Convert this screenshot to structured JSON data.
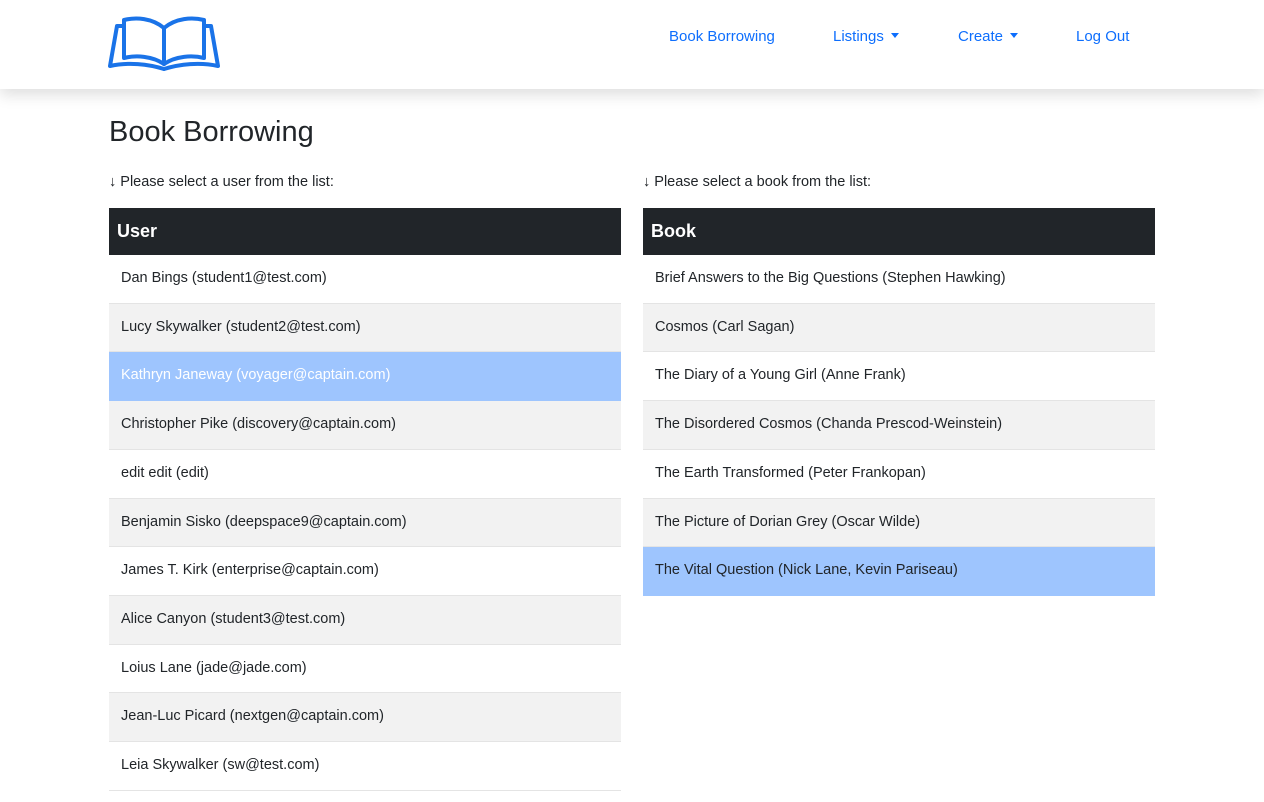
{
  "nav": {
    "logo": "book-logo-icon",
    "links": [
      "Book Borrowing",
      "Listings",
      "Create",
      "Log Out"
    ],
    "accent_color": "#0d6efd"
  },
  "page": {
    "title": "Book Borrowing"
  },
  "users_panel": {
    "hint": "↓ Please select a user from the list:",
    "header": "User",
    "selected_index": 2,
    "items": [
      "Dan Bings (student1@test.com)",
      "Lucy Skywalker (student2@test.com)",
      "Kathryn Janeway (voyager@captain.com)",
      "Christopher Pike (discovery@captain.com)",
      "edit edit (edit)",
      "Benjamin Sisko (deepspace9@captain.com)",
      "James T. Kirk (enterprise@captain.com)",
      "Alice Canyon (student3@test.com)",
      "Loius Lane (jade@jade.com)",
      "Jean-Luc Picard (nextgen@captain.com)",
      "Leia Skywalker (sw@test.com)"
    ]
  },
  "books_panel": {
    "hint": "↓ Please select a book from the list:",
    "header": "Book",
    "selected_index": 6,
    "items": [
      "Brief Answers to the Big Questions (Stephen Hawking)",
      "Cosmos (Carl Sagan)",
      "The Diary of a Young Girl (Anne Frank)",
      "The Disordered Cosmos (Chanda Prescod-Weinstein)",
      "The Earth Transformed (Peter Frankopan)",
      "The Picture of Dorian Grey (Oscar Wilde)",
      "The Vital Question (Nick Lane, Kevin Pariseau)"
    ]
  },
  "colors": {
    "header_bg": "#212529",
    "stripe_bg": "#f2f2f2",
    "selected_bg": "#9ec5fe"
  }
}
